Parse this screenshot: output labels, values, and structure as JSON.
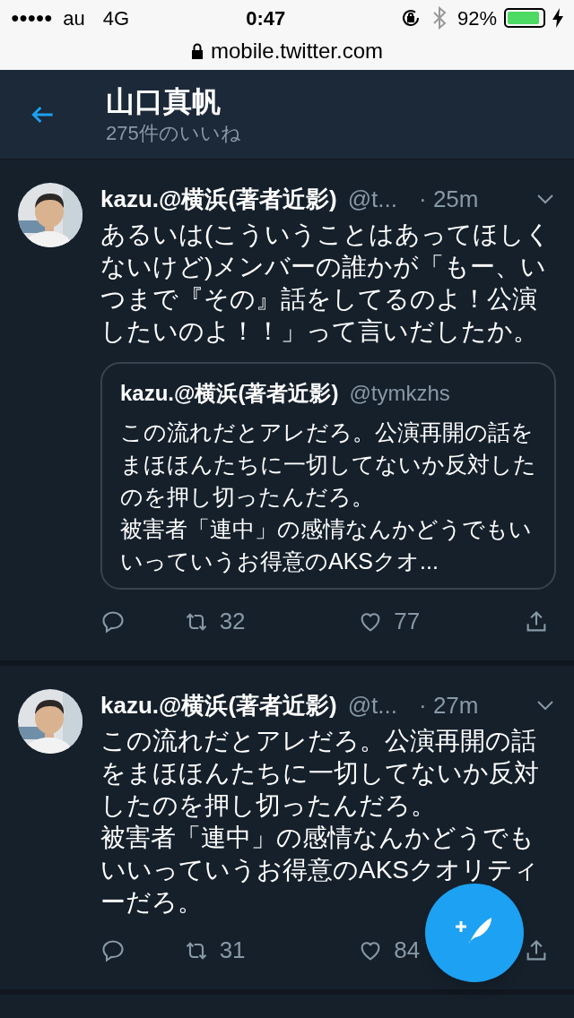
{
  "status_bar": {
    "signal_dots": "●●●●●",
    "carrier": "au",
    "network": "4G",
    "time": "0:47",
    "battery": "92%"
  },
  "url_bar": {
    "url": "mobile.twitter.com"
  },
  "header": {
    "title": "山口真帆",
    "subtitle": "275件のいいね"
  },
  "tweets": [
    {
      "name": "kazu.@横浜(著者近影)",
      "handle": "@t...",
      "time": "· 25m",
      "paragraphs": [
        "あるいは(こういうことはあってほしくないけど)メンバーの誰かが「もー、いつまで『その』話をしてるのよ！公演したいのよ！！」って言いだしたか。"
      ],
      "quote": {
        "name": "kazu.@横浜(著者近影)",
        "handle": "@tymkzhs",
        "paragraphs": [
          "この流れだとアレだろ。公演再開の話をまほほんたちに一切してないか反対したのを押し切ったんだろ。",
          "被害者「連中」の感情なんかどうでもいいっていうお得意のAKSクオ..."
        ]
      },
      "retweets": "32",
      "likes": "77"
    },
    {
      "name": "kazu.@横浜(著者近影)",
      "handle": "@t...",
      "time": "· 27m",
      "paragraphs": [
        "この流れだとアレだろ。公演再開の話をまほほんたちに一切してないか反対したのを押し切ったんだろ。",
        "被害者「連中」の感情なんかどうでもいいっていうお得意のAKSクオリティーだろ。"
      ],
      "retweets": "31",
      "likes": "84"
    }
  ]
}
